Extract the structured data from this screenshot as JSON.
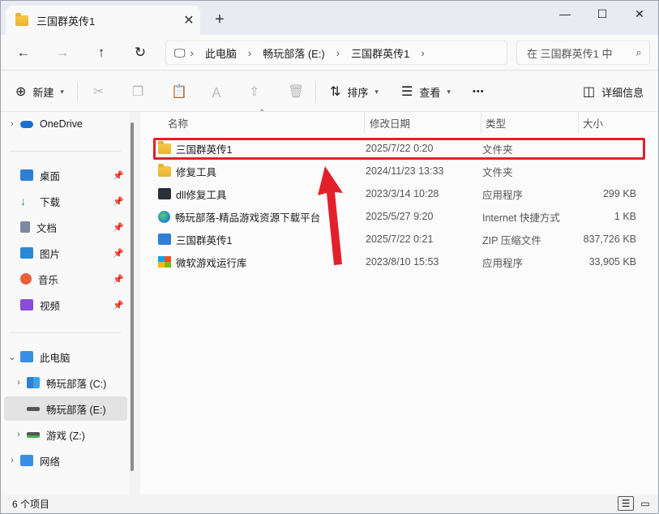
{
  "window": {
    "tab_title": "三国群英传1",
    "new_tab": "+",
    "minimize": "—",
    "maximize": "☐",
    "close": "✕"
  },
  "address": {
    "crumbs": [
      "此电脑",
      "畅玩部落 (E:)",
      "三国群英传1"
    ],
    "search_placeholder": "在 三国群英传1 中"
  },
  "toolbar": {
    "new_label": "新建",
    "sort_label": "排序",
    "view_label": "查看",
    "more_label": "•••",
    "details_label": "详细信息"
  },
  "sidebar": {
    "onedrive": "OneDrive",
    "quick": [
      {
        "label": "桌面",
        "icon": "desktop-icon",
        "color": "#2f7fd6"
      },
      {
        "label": "下载",
        "icon": "download-icon",
        "color": "#1e8e3e"
      },
      {
        "label": "文档",
        "icon": "document-icon",
        "color": "#7a8aa0"
      },
      {
        "label": "图片",
        "icon": "pictures-icon",
        "color": "#2b88d8"
      },
      {
        "label": "音乐",
        "icon": "music-icon",
        "color": "#e8603c"
      },
      {
        "label": "视频",
        "icon": "video-icon",
        "color": "#8a4bd8"
      }
    ],
    "this_pc": "此电脑",
    "drives": [
      {
        "label": "畅玩部落 (C:)",
        "icon": "windows-drive-icon",
        "selected": false
      },
      {
        "label": "畅玩部落 (E:)",
        "icon": "drive-icon",
        "selected": true
      },
      {
        "label": "游戏 (Z:)",
        "icon": "drive-icon",
        "selected": false
      }
    ],
    "network": "网络"
  },
  "columns": {
    "name": "名称",
    "date": "修改日期",
    "type": "类型",
    "size": "大小"
  },
  "files": [
    {
      "name": "三国群英传1",
      "date": "2025/7/22 0:20",
      "type": "文件夹",
      "size": "",
      "icon": "folder-icon"
    },
    {
      "name": "修复工具",
      "date": "2024/11/23 13:33",
      "type": "文件夹",
      "size": "",
      "icon": "folder-icon"
    },
    {
      "name": "dll修复工具",
      "date": "2023/3/14 10:28",
      "type": "应用程序",
      "size": "299 KB",
      "icon": "app-icon"
    },
    {
      "name": "畅玩部落-精品游戏资源下载平台",
      "date": "2025/5/27 9:20",
      "type": "Internet 快捷方式",
      "size": "1 KB",
      "icon": "edge-icon"
    },
    {
      "name": "三国群英传1",
      "date": "2025/7/22 0:21",
      "type": "ZIP 压缩文件",
      "size": "837,726 KB",
      "icon": "zip-icon"
    },
    {
      "name": "微软游戏运行库",
      "date": "2023/8/10 15:53",
      "type": "应用程序",
      "size": "33,905 KB",
      "icon": "windows-app-icon"
    }
  ],
  "status": {
    "count": "6 个项目"
  },
  "colors": {
    "highlight": "#e3202a",
    "accent": "#0067c0"
  }
}
